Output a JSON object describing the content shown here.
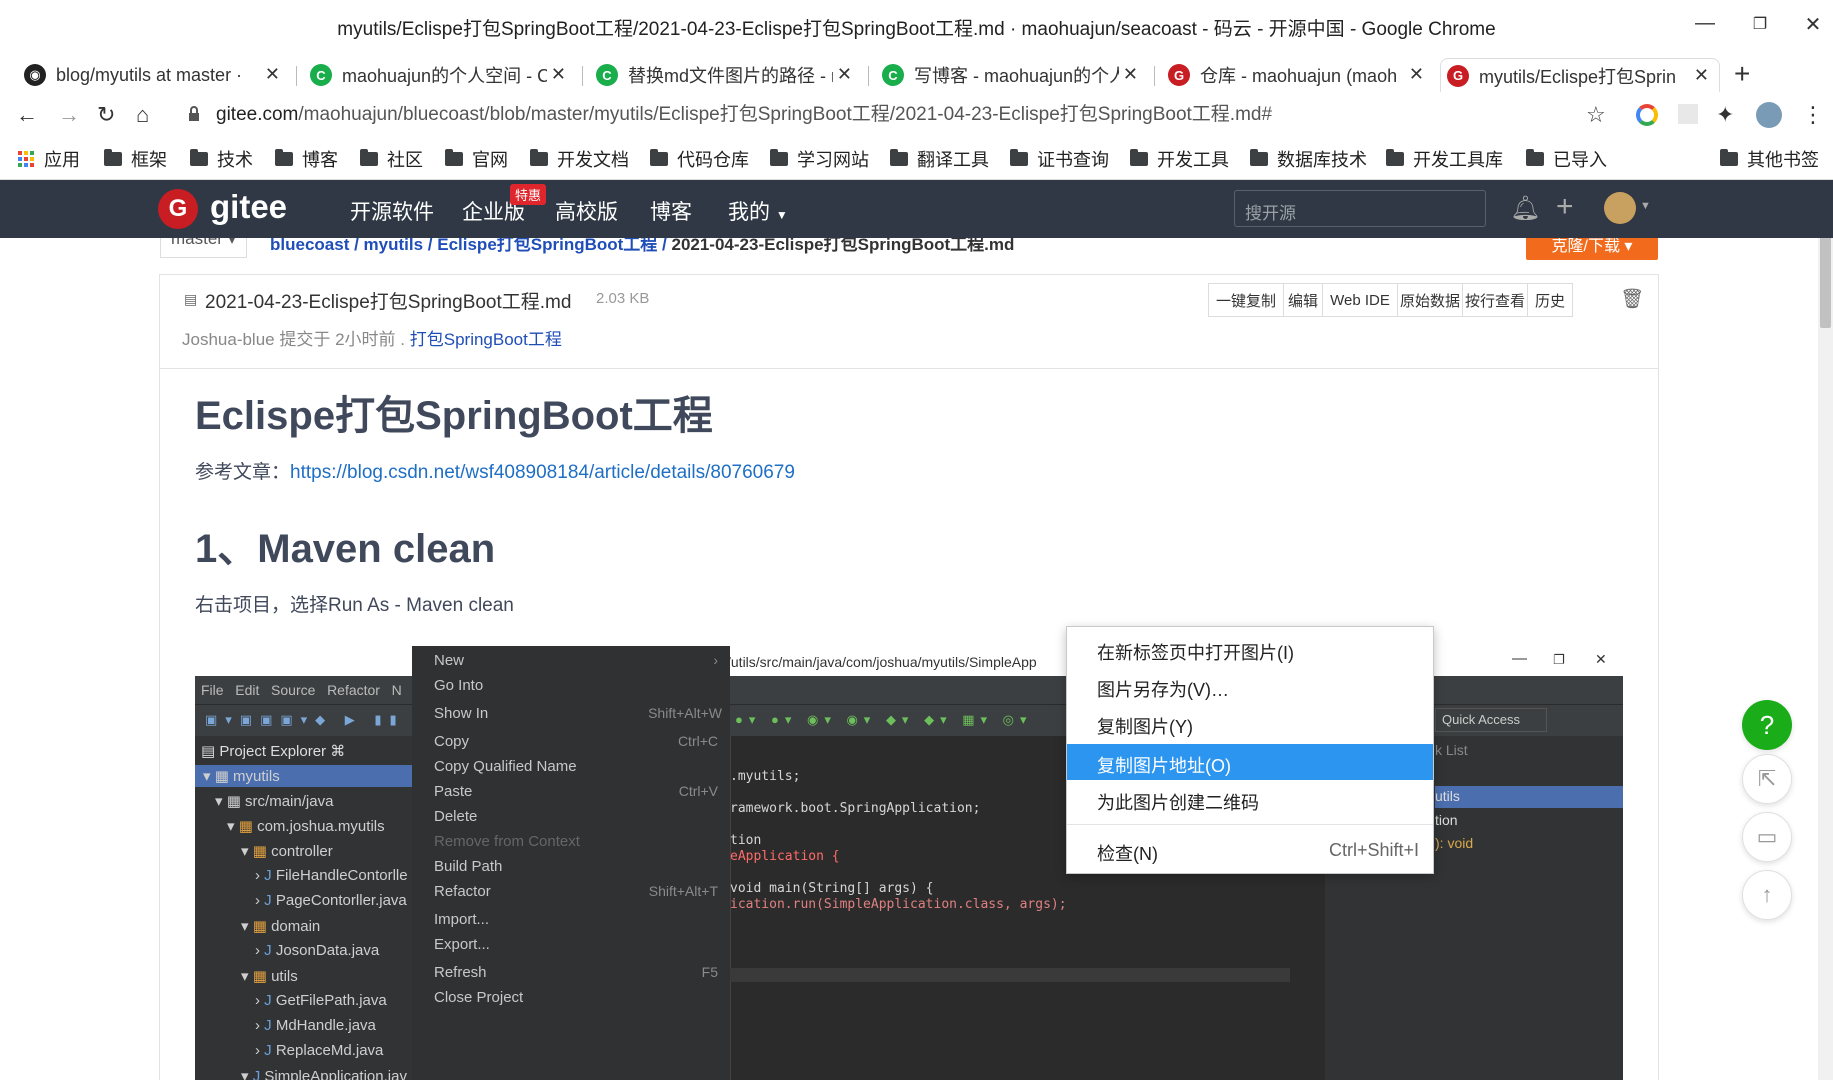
{
  "window": {
    "title": "myutils/Eclispe打包SpringBoot工程/2021-04-23-Eclispe打包SpringBoot工程.md · maohuajun/seacoast - 码云 - 开源中国 - Google Chrome"
  },
  "tabs": [
    {
      "label": "blog/myutils at master ·",
      "icon": "github-icon"
    },
    {
      "label": "maohuajun的个人空间 - C",
      "icon": "gitee-c-icon"
    },
    {
      "label": "替换md文件图片的路径 - r",
      "icon": "gitee-c-icon"
    },
    {
      "label": "写博客 - maohuajun的个人",
      "icon": "gitee-c-icon"
    },
    {
      "label": "仓库 - maohuajun (maoh",
      "icon": "gitee-g-icon"
    },
    {
      "label": "myutils/Eclispe打包Sprin",
      "icon": "gitee-g-icon"
    }
  ],
  "address": {
    "host": "gitee.com",
    "path": "/maohuajun/bluecoast/blob/master/myutils/Eclispe打包SpringBoot工程/2021-04-23-Eclispe打包SpringBoot工程.md#"
  },
  "bookmarks": {
    "apps": "应用",
    "items": [
      "框架",
      "技术",
      "博客",
      "社区",
      "官网",
      "开发文档",
      "代码仓库",
      "学习网站",
      "翻译工具",
      "证书查询",
      "开发工具",
      "数据库技术",
      "开发工具库",
      "已导入"
    ],
    "other": "其他书签"
  },
  "gitee": {
    "logo": "gitee",
    "nav": [
      "开源软件",
      "企业版",
      "高校版",
      "博客",
      "我的"
    ],
    "badge": "特惠",
    "search_placeholder": "搜开源"
  },
  "breadcrumb": {
    "branch": "master",
    "parts": [
      "bluecoast",
      "myutils",
      "Eclispe打包SpringBoot工程"
    ],
    "current": "2021-04-23-Eclispe打包SpringBoot工程.md",
    "clone_button": "克隆/下载"
  },
  "file": {
    "name": "2021-04-23-Eclispe打包SpringBoot工程.md",
    "size": "2.03 KB",
    "author": "Joshua-blue",
    "commit_prefix": "提交于",
    "time": "2小时前",
    "commit_msg": "打包SpringBoot工程",
    "buttons": [
      "一键复制",
      "编辑",
      "Web IDE",
      "原始数据",
      "按行查看",
      "历史"
    ]
  },
  "doc": {
    "h1": "Eclispe打包SpringBoot工程",
    "ref_label": "参考文章：",
    "ref_link": "https://blog.csdn.net/wsf408908184/article/details/80760679",
    "h2": "1、Maven clean",
    "p1": "右击项目，选择Run As - Maven clean"
  },
  "eclipse": {
    "menubar": [
      "File",
      "Edit",
      "Source",
      "Refactor",
      "N"
    ],
    "title_path": "/utils/src/main/java/com/joshua/myutils/SimpleApp",
    "quick_access": "Quick Access",
    "project_explorer": "Project Explorer",
    "tree": [
      "myutils",
      "src/main/java",
      "com.joshua.myutils",
      "controller",
      "FileHandleContorlle",
      "PageContorller.java",
      "domain",
      "JosonData.java",
      "utils",
      "GetFilePath.java",
      "MdHandle.java",
      "ReplaceMd.java",
      "SimpleApplication.jav"
    ],
    "context_menu": [
      {
        "label": "New",
        "shortcut": ""
      },
      {
        "label": "Go Into",
        "shortcut": ""
      },
      {
        "label": "Show In",
        "shortcut": "Shift+Alt+W"
      },
      {
        "label": "Copy",
        "shortcut": "Ctrl+C"
      },
      {
        "label": "Copy Qualified Name",
        "shortcut": ""
      },
      {
        "label": "Paste",
        "shortcut": "Ctrl+V"
      },
      {
        "label": "Delete",
        "shortcut": ""
      },
      {
        "label": "Remove from Context",
        "shortcut": ""
      },
      {
        "label": "Build Path",
        "shortcut": ""
      },
      {
        "label": "Refactor",
        "shortcut": "Shift+Alt+T"
      },
      {
        "label": "Import...",
        "shortcut": ""
      },
      {
        "label": "Export...",
        "shortcut": ""
      },
      {
        "label": "Refresh",
        "shortcut": "F5"
      },
      {
        "label": "Close Project",
        "shortcut": ""
      }
    ],
    "code": [
      ".myutils;",
      "ramework.boot.SpringApplication;",
      "tion",
      "eApplication {",
      "void main(String[] args) {",
      "ication.run(SimpleApplication.class, args);"
    ],
    "outline": [
      "k List",
      "utils",
      "tion",
      "): void"
    ]
  },
  "image_context_menu": [
    {
      "label": "在新标签页中打开图片(I)",
      "shortcut": ""
    },
    {
      "label": "图片另存为(V)…",
      "shortcut": ""
    },
    {
      "label": "复制图片(Y)",
      "shortcut": ""
    },
    {
      "label": "复制图片地址(O)",
      "shortcut": "",
      "selected": true
    },
    {
      "label": "为此图片创建二维码",
      "shortcut": ""
    },
    {
      "label": "检查(N)",
      "shortcut": "Ctrl+Shift+I"
    }
  ],
  "fab": {
    "help": "?"
  }
}
